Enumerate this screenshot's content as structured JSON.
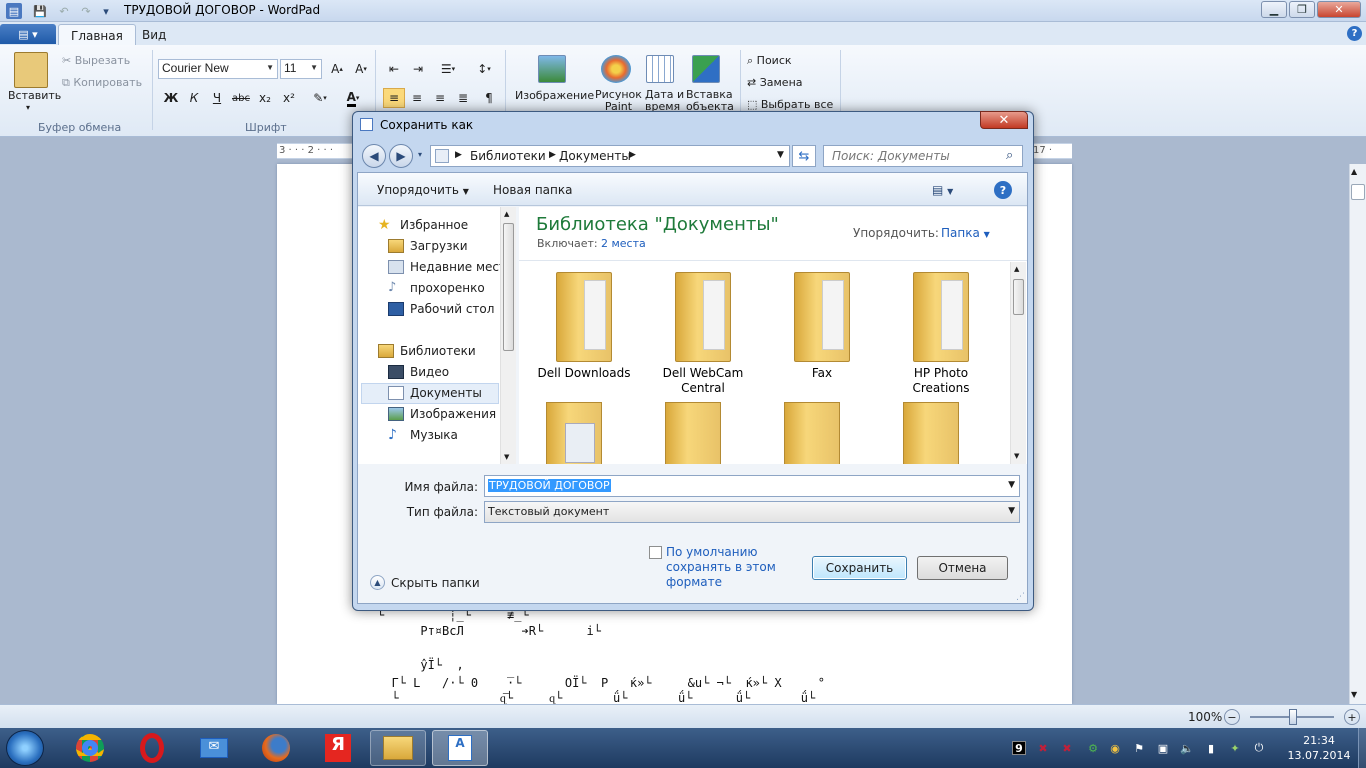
{
  "wordpad": {
    "title": "ТРУДОВОЙ ДОГОВОР - WordPad",
    "tabs": [
      "Главная",
      "Вид"
    ],
    "ribbon": {
      "paste_label": "Вставить",
      "cut_label": "Вырезать",
      "copy_label": "Копировать",
      "clipboard_group": "Буфер обмена",
      "font_name": "Courier New",
      "font_size": "11",
      "bold": "Ж",
      "italic": "К",
      "underline": "Ч",
      "strike": "abc",
      "subscript": "x₂",
      "superscript": "x²",
      "font_group": "Шрифт",
      "font_color": "A",
      "insert_image": "Изображение",
      "insert_paint_1": "Рисунок",
      "insert_paint_2": "Paint",
      "insert_date_1": "Дата и",
      "insert_date_2": "время",
      "insert_object_1": "Вставка",
      "insert_object_2": "объекта",
      "find": "Поиск",
      "replace": "Замена",
      "select_all": "Выбрать все"
    },
    "ruler_left": "3 · · · 2 · · ·",
    "ruler_right": "17 ·",
    "doc_lines": [
      "└         ┆̲└     ≢̲└",
      "      Рт¤ВсЛ        ➔R└      i└",
      "",
      "      ŷÏ└  ,",
      "  Г└ L   /·└ 0    ̅·└      OÏ└  P   ќ»└     &u└ ¬└  ќ»└ X     °",
      "  └              ɋ̅└     ɋ└       ǘ└       ǘ└      ǘ└       ǘ└"
    ],
    "zoom": "100%"
  },
  "dialog": {
    "title": "Сохранить как",
    "breadcrumb": [
      "Библиотеки",
      "Документы"
    ],
    "search_placeholder": "Поиск: Документы",
    "organize": "Упорядочить",
    "new_folder": "Новая папка",
    "nav": {
      "favorites": "Избранное",
      "downloads": "Загрузки",
      "recent": "Недавние места",
      "user": "прохоренко",
      "desktop": "Рабочий стол",
      "libraries": "Библиотеки",
      "video": "Видео",
      "documents": "Документы",
      "images": "Изображения",
      "music": "Музыка"
    },
    "library_title": "Библиотека \"Документы\"",
    "includes_label": "Включает:",
    "includes_value": "2 места",
    "arrange_label": "Упорядочить:",
    "arrange_value": "Папка",
    "folders": [
      "Dell Downloads",
      "Dell WebCam Central",
      "Fax",
      "HP Photo Creations"
    ],
    "filename_label": "Имя файла:",
    "filename_value": "ТРУДОВОЙ ДОГОВОР",
    "filetype_label": "Тип файла:",
    "filetype_value": "Текстовый документ",
    "default_save_line1": "По умолчанию",
    "default_save_line2": "сохранять в этом",
    "default_save_line3": "формате",
    "save": "Сохранить",
    "cancel": "Отмена",
    "hide_folders": "Скрыть папки"
  },
  "taskbar": {
    "clock_time": "21:34",
    "clock_date": "13.07.2014",
    "tray_number": "9"
  }
}
